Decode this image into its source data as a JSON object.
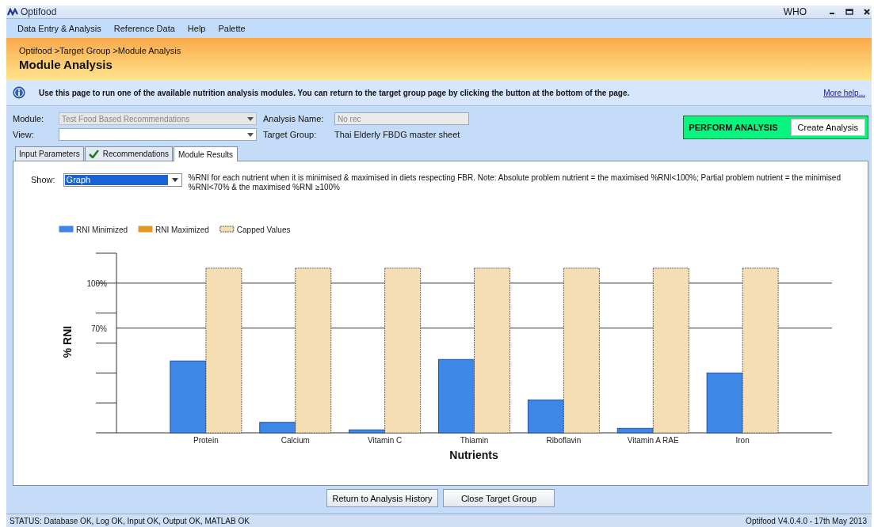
{
  "window": {
    "title": "Optifood",
    "user": "WHO"
  },
  "menu": [
    "Data Entry & Analysis",
    "Reference Data",
    "Help",
    "Palette"
  ],
  "header": {
    "breadcrumb": "Optifood >Target Group >Module Analysis",
    "title": "Module Analysis"
  },
  "info": {
    "text": "Use this page to run one of the available nutrition analysis modules.  You can return to the target group page by clicking the button at the bottom of the page.",
    "link": "More help..."
  },
  "form": {
    "fields": [
      {
        "kind": "dropdown",
        "label": "Module:",
        "value": "Test Food Based Recommendations",
        "disabled": true
      },
      {
        "kind": "text",
        "label": "Analysis Name:",
        "value": "No rec",
        "disabled": true
      },
      {
        "kind": "dropdown",
        "label": "View:",
        "disabled": false
      },
      {
        "kind": "static",
        "label": "Target Group:",
        "value": "Thai Elderly FBDG master sheet"
      }
    ]
  },
  "perform": {
    "label": "PERFORM ANALYSIS",
    "button": "Create Analysis"
  },
  "tabs": [
    {
      "label": "Input Parameters",
      "selected": false,
      "complete": false
    },
    {
      "label": "Recommendations",
      "selected": false,
      "complete": true
    },
    {
      "label": "Module Results",
      "selected": true,
      "complete": false
    }
  ],
  "results": {
    "show_label": "Show:",
    "show_value": "Graph",
    "note": "%RNI for each nutrient when it is minimised & maximised in diets respecting FBR.  Note:  Absolute problem nutrient = the maximised %RNI<100%; Partial problem nutrient = the minimised %RNI<70% & the maximised %RNI ≥100%",
    "chart_data": {
      "type": "bar",
      "xlabel": "Nutrients",
      "ylabel": "% RNI",
      "categories": [
        "Protein",
        "Calcium",
        "Vitamin C",
        "Thiamin",
        "Riboflavin",
        "Vitamin A RAE",
        "Iron"
      ],
      "series": [
        {
          "name": "RNI Minimized",
          "color": "#3d87e6",
          "values": [
            48,
            7,
            2,
            49,
            22,
            3,
            40
          ]
        },
        {
          "name": "RNI Maximized",
          "color": "#e09a22",
          "values": [
            null,
            null,
            null,
            null,
            null,
            null,
            null
          ]
        },
        {
          "name": "Capped Values",
          "color": "#f5deb3",
          "values": [
            110,
            110,
            110,
            110,
            110,
            110,
            110
          ]
        }
      ],
      "legend": true,
      "ylim": [
        0,
        120
      ],
      "yticks": [
        {
          "value": 70,
          "label": "70%"
        },
        {
          "value": 100,
          "label": "100%"
        }
      ]
    }
  },
  "buttons": [
    "Return to Analysis History",
    "Close Target Group"
  ],
  "status_bar": {
    "left": "STATUS: Database OK, Log OK, Input OK, Output OK, MATLAB OK",
    "right": "Optifood V4.0.4.0 - 17th May 2013"
  }
}
